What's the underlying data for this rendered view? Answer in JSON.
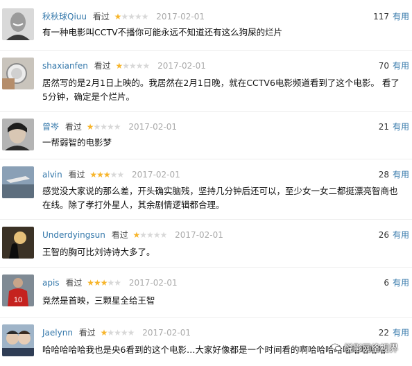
{
  "labels": {
    "saw": "看过",
    "useful": "有用"
  },
  "colors": {
    "username": "#3377aa",
    "star_on": "#f7b52b",
    "star_off": "#d8d8d8",
    "date": "#aaaaaa"
  },
  "comments": [
    {
      "user": "秋秋球Qiuu",
      "rating": 1,
      "date": "2017-02-01",
      "votes": "117",
      "text": "有一种电影叫CCTV不播你可能永远不知道还有这么狗屎的烂片"
    },
    {
      "user": "shaxianfen",
      "rating": 1,
      "date": "2017-02-01",
      "votes": "70",
      "text": "居然写的是2月1日上映的。我居然在2月1日晚，就在CCTV6电影频道看到了这个电影。 看了5分钟，确定是个烂片。"
    },
    {
      "user": "曾岑",
      "rating": 1,
      "date": "2017-02-01",
      "votes": "21",
      "text": "一帮弱智的电影梦"
    },
    {
      "user": "alvin",
      "rating": 3,
      "date": "2017-02-01",
      "votes": "28",
      "text": "感觉没大家说的那么差，开头确实脑残，坚持几分钟后还可以，至少女一女二都挺漂亮智商也在线。除了孝打外星人，其余剧情逻辑都合理。"
    },
    {
      "user": "Underdyingsun",
      "rating": 1,
      "date": "2017-02-01",
      "votes": "26",
      "text": "王智的胸可比刘诗诗大多了。"
    },
    {
      "user": "apis",
      "rating": 3,
      "date": "2017-02-01",
      "votes": "6",
      "text": "竟然是首映，三颗星全给王智"
    },
    {
      "user": "Jaelynn",
      "rating": 1,
      "date": "2017-02-01",
      "votes": "22",
      "text": "哈哈哈哈哈我也是央6看到的这个电影…大家好像都是一个时间看的啊哈哈哈哈哈哈哈哈哈"
    }
  ],
  "watermark": {
    "text": "悦影网络视界"
  }
}
